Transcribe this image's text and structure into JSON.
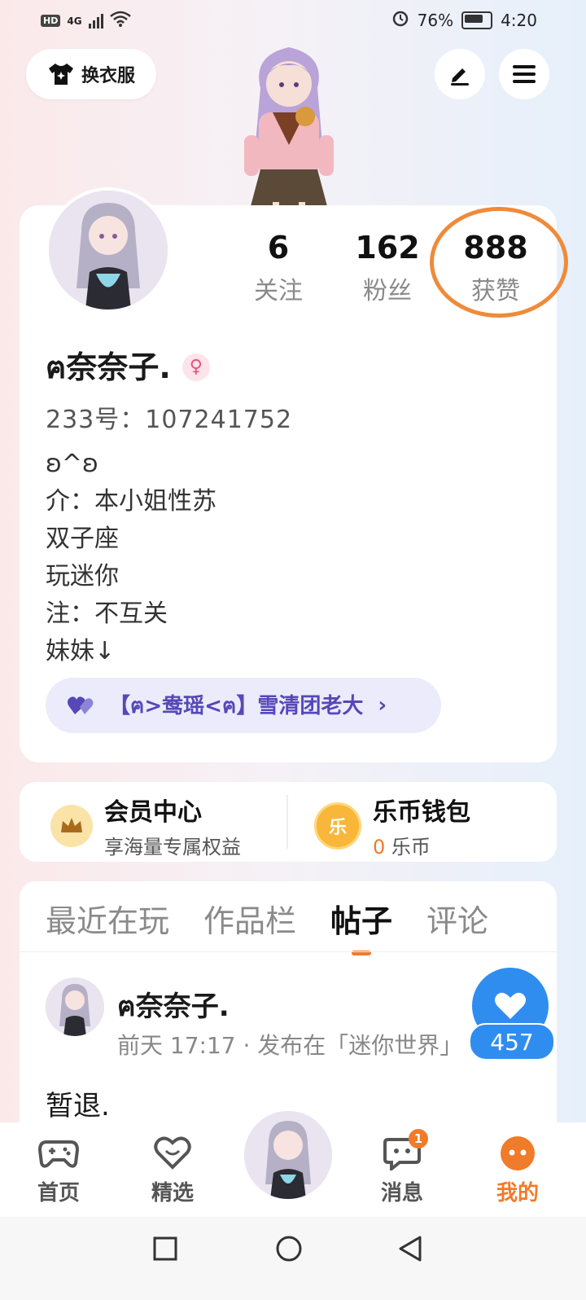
{
  "status_bar": {
    "left_label": "HD",
    "network": "4G",
    "battery": "76%",
    "time": "4:20"
  },
  "top": {
    "dress_button": "换衣服"
  },
  "profile": {
    "stats": [
      {
        "value": "6",
        "label": "关注"
      },
      {
        "value": "162",
        "label": "粉丝"
      },
      {
        "value": "888",
        "label": "获赞"
      }
    ],
    "name": "ฅ奈奈子.",
    "gender_symbol": "♀",
    "uid": "233号：107241752",
    "bio": [
      "ʚ^ʚ",
      "介：本小姐性苏",
      "双子座",
      "玩迷你",
      "注：不互关",
      "妹妹↓"
    ],
    "guild": "【ฅ>鸯瑶<ฅ】雪清团老大"
  },
  "member": {
    "title": "会员中心",
    "subtitle": "享海量专属权益"
  },
  "wallet": {
    "title": "乐币钱包",
    "icon_text": "乐",
    "amount": "0",
    "unit": "乐币"
  },
  "tabs": [
    {
      "label": "最近在玩",
      "active": false
    },
    {
      "label": "作品栏",
      "active": false
    },
    {
      "label": "帖子",
      "active": true
    },
    {
      "label": "评论",
      "active": false
    }
  ],
  "post": {
    "author": "ฅ奈奈子.",
    "meta": "前天 17:17 · 发布在「迷你世界」",
    "body": "暂退.",
    "likes": "457"
  },
  "bottom_nav": {
    "home": "首页",
    "featured": "精选",
    "messages": "消息",
    "messages_badge": "1",
    "mine": "我的"
  },
  "colors": {
    "accent": "#f07b2a",
    "like_blue": "#2f8df0",
    "guild_purple": "#5548b7",
    "highlight_circle": "#ee8b3a"
  }
}
